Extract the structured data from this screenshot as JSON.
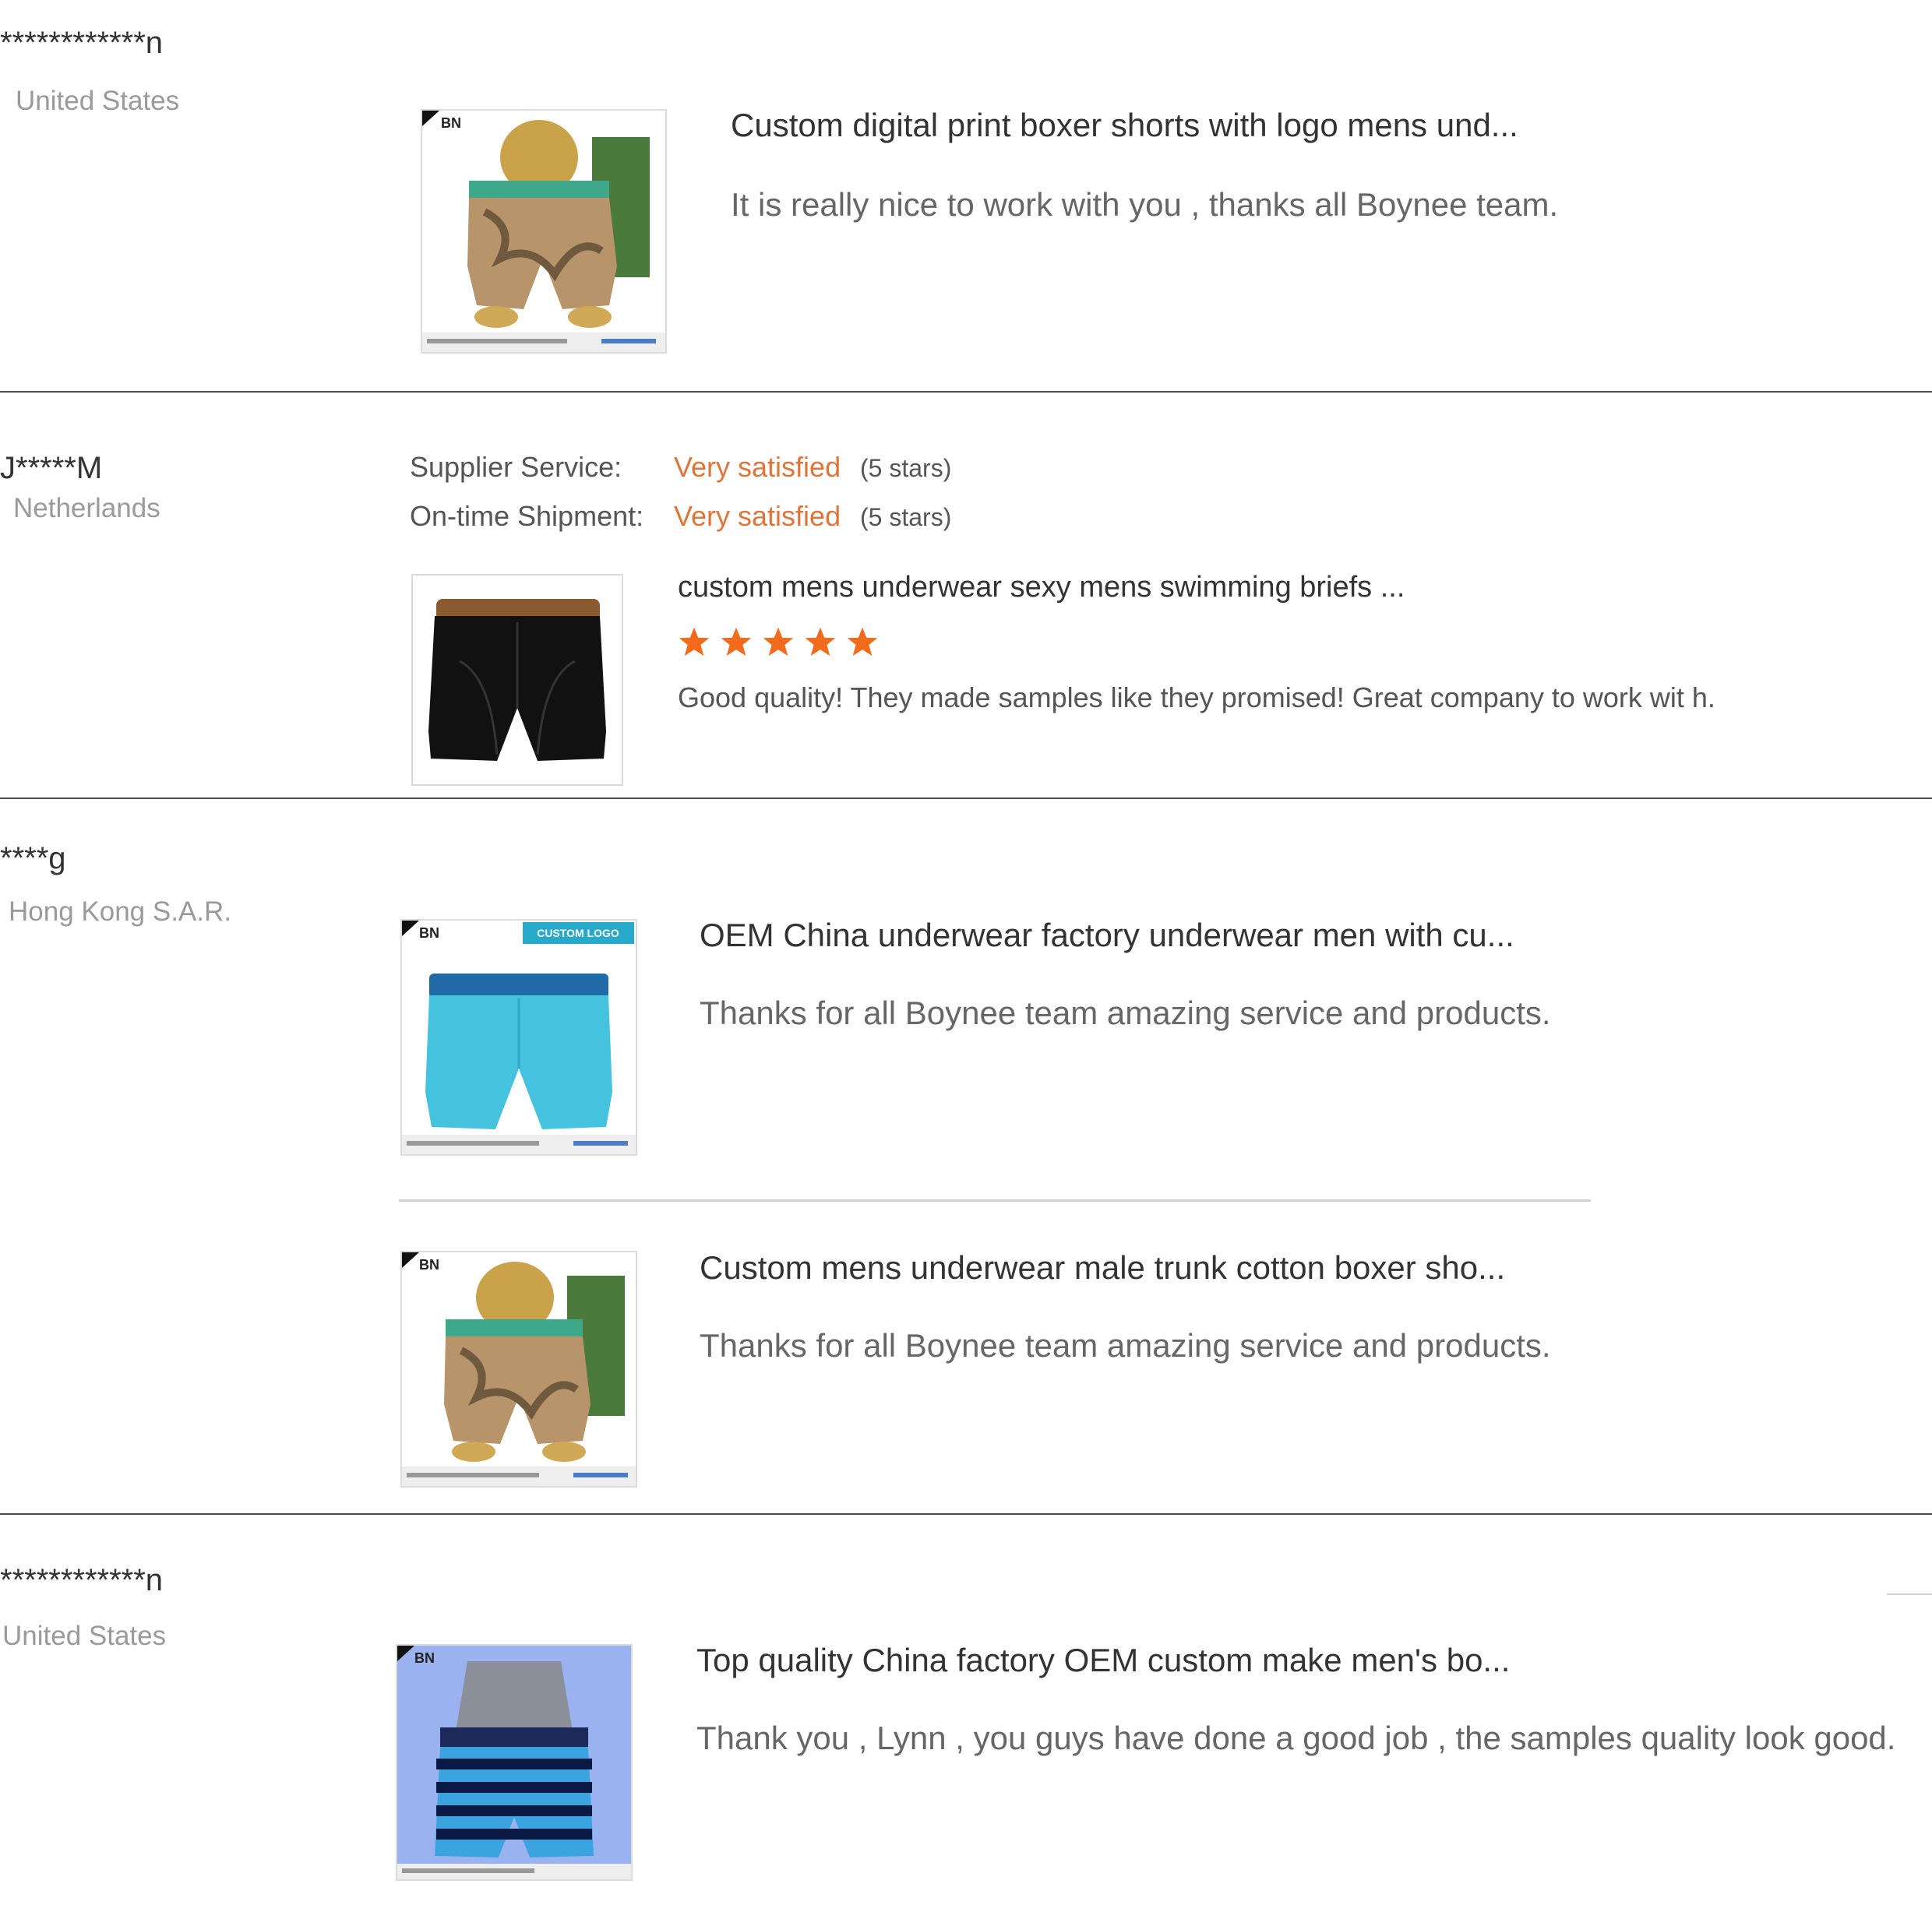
{
  "colors": {
    "accent": "#e0753a",
    "star": "#f26a1b",
    "text": "#333333",
    "muted": "#9a9a9a"
  },
  "reviews": [
    {
      "reviewer": "************n",
      "country": "United States",
      "products": [
        {
          "title": "Custom digital print boxer shorts with logo mens und...",
          "comment": "It is really nice to work with you , thanks all Boynee team.",
          "image": "camo-boxer-on-mannequin"
        }
      ]
    },
    {
      "reviewer": "J*****M",
      "country": "Netherlands",
      "ratings": [
        {
          "label": "Supplier Service:",
          "value": "Very satisfied",
          "stars_text": "(5 stars)"
        },
        {
          "label": "On-time Shipment:",
          "value": "Very satisfied",
          "stars_text": "(5 stars)"
        }
      ],
      "products": [
        {
          "title": "custom mens underwear sexy mens swimming briefs ...",
          "rating": 5,
          "comment": "Good quality! They made samples like they promised! Great company to work wit h.",
          "image": "black-boxer-brief"
        }
      ]
    },
    {
      "reviewer": "****g",
      "country": "Hong Kong S.A.R.",
      "products": [
        {
          "title": "OEM China underwear factory underwear men with cu...",
          "comment": "Thanks for all Boynee team amazing service and products.",
          "image": "turquoise-boxer-custom-logo",
          "badge": "CUSTOM LOGO"
        },
        {
          "title": "Custom mens underwear male trunk cotton boxer sho...",
          "comment": "Thanks for all Boynee team amazing service and products.",
          "image": "camo-boxer-on-mannequin"
        }
      ]
    },
    {
      "reviewer": "************n",
      "country": "United States",
      "products": [
        {
          "title": "Top quality China factory OEM custom make men's bo...",
          "comment": "Thank you , Lynn , you guys have done a good job , the samples quality look good.",
          "image": "striped-boxer-on-mannequin"
        }
      ]
    }
  ]
}
